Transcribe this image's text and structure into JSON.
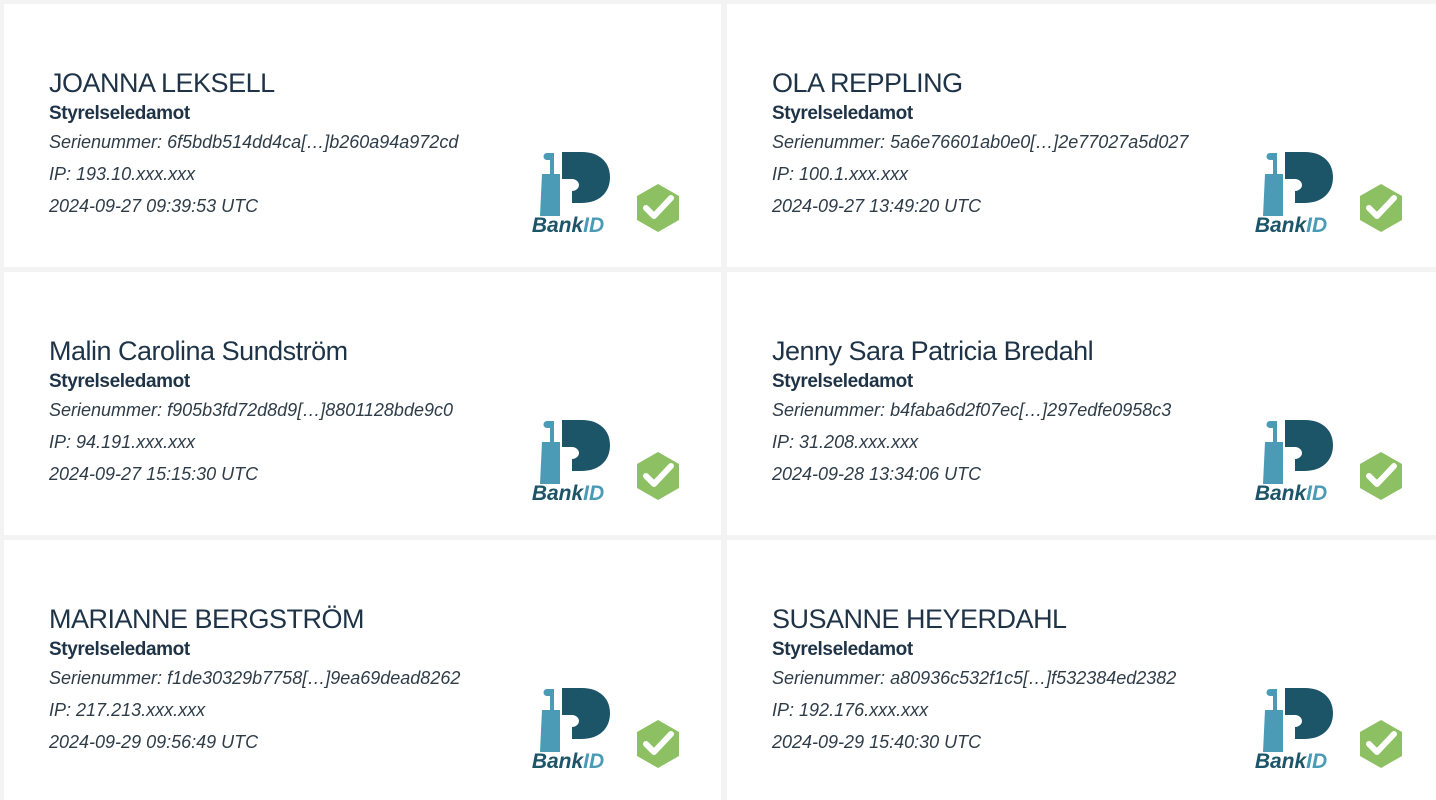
{
  "signers": [
    {
      "name": "JOANNA LEKSELL",
      "role": "Styrelseledamot",
      "serial_label": "Serienummer:",
      "serial": "6f5bdb514dd4ca[…]b260a94a972cd",
      "ip_label": "IP:",
      "ip": "193.10.xxx.xxx",
      "timestamp": "2024-09-27 09:39:53 UTC"
    },
    {
      "name": "OLA REPPLING",
      "role": "Styrelseledamot",
      "serial_label": "Serienummer:",
      "serial": "5a6e76601ab0e0[…]2e77027a5d027",
      "ip_label": "IP:",
      "ip": "100.1.xxx.xxx",
      "timestamp": "2024-09-27 13:49:20 UTC"
    },
    {
      "name": "Malin Carolina Sundström",
      "role": "Styrelseledamot",
      "serial_label": "Serienummer:",
      "serial": "f905b3fd72d8d9[…]8801128bde9c0",
      "ip_label": "IP:",
      "ip": "94.191.xxx.xxx",
      "timestamp": "2024-09-27 15:15:30 UTC"
    },
    {
      "name": "Jenny Sara Patricia Bredahl",
      "role": "Styrelseledamot",
      "serial_label": "Serienummer:",
      "serial": "b4faba6d2f07ec[…]297edfe0958c3",
      "ip_label": "IP:",
      "ip": "31.208.xxx.xxx",
      "timestamp": "2024-09-28 13:34:06 UTC"
    },
    {
      "name": "MARIANNE BERGSTRÖM",
      "role": "Styrelseledamot",
      "serial_label": "Serienummer:",
      "serial": "f1de30329b7758[…]9ea69dead8262",
      "ip_label": "IP:",
      "ip": "217.213.xxx.xxx",
      "timestamp": "2024-09-29 09:56:49 UTC"
    },
    {
      "name": "SUSANNE HEYERDAHL",
      "role": "Styrelseledamot",
      "serial_label": "Serienummer:",
      "serial": "a80936c532f1c5[…]f532384ed2382",
      "ip_label": "IP:",
      "ip": "192.176.xxx.xxx",
      "timestamp": "2024-09-29 15:40:30 UTC"
    }
  ],
  "logo": {
    "icon": "bankid-logo-icon",
    "text": "BankID",
    "color_dark": "#1c5468",
    "color_light": "#4b9bb7"
  },
  "verified": {
    "icon": "verified-check-icon",
    "color": "#8cc063"
  }
}
